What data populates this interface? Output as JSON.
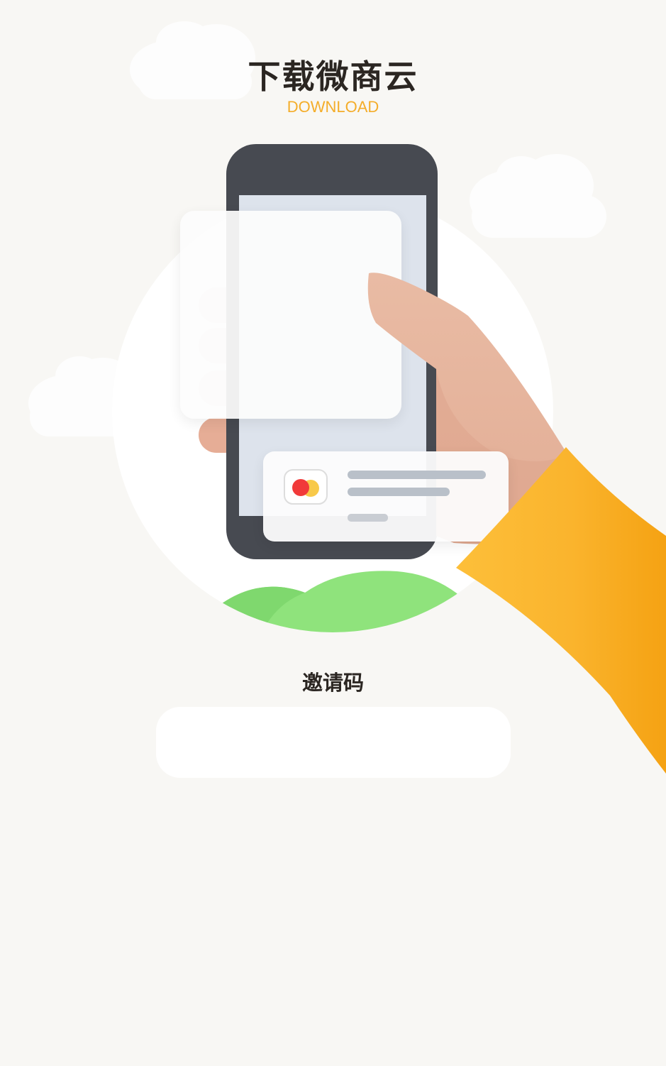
{
  "header": {
    "title": "下载微商云",
    "subtitle": "DOWNLOAD"
  },
  "invite": {
    "label": "邀请码",
    "value": "",
    "placeholder": ""
  },
  "colors": {
    "background": "#f8f7f4",
    "title": "#2b2622",
    "accent": "#f4ad2a",
    "sleeve": "#fbb630",
    "phone_body": "#474a51",
    "hill": "#8fe37c",
    "skin": "#e8b9a2"
  },
  "icons": {
    "card_logo": "card-logo-icon"
  }
}
